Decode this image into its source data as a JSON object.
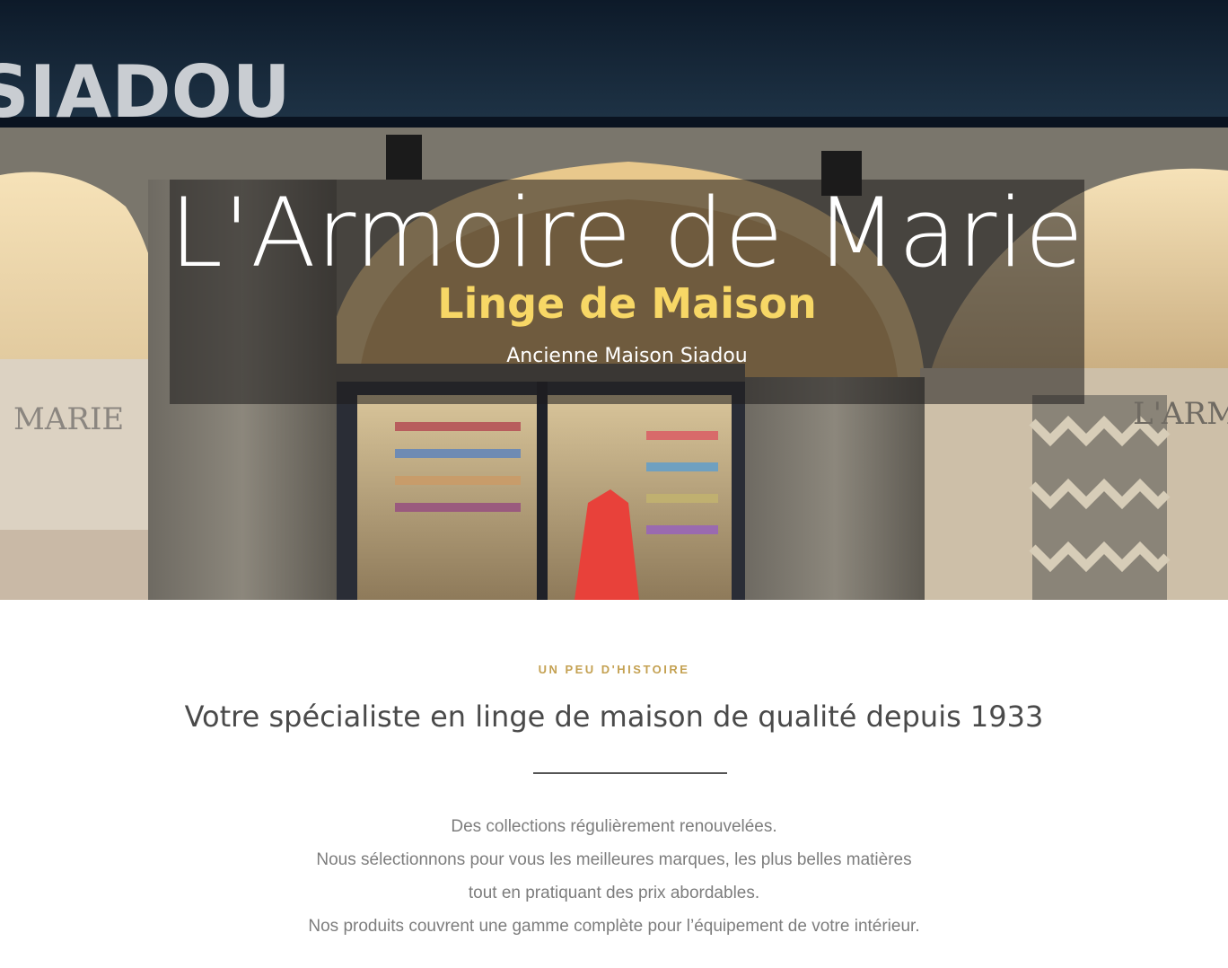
{
  "hero": {
    "title": "L'Armoire de Marie",
    "subtitle": "Linge de Maison",
    "tagline": "Ancienne Maison Siadou",
    "storefront_sign": "SIADOU",
    "window_sign_left": "MARIE",
    "window_sign_right": "L'ARM",
    "colors": {
      "subtitle": "#f7d766",
      "title": "#ffffff"
    }
  },
  "history": {
    "eyebrow": "UN PEU D'HISTOIRE",
    "headline": "Votre spécialiste en linge de maison de qualité depuis 1933",
    "lines": [
      "Des collections régulièrement renouvelées.",
      "Nous sélectionnons pour vous les meilleures marques, les plus belles matières",
      "tout en pratiquant des prix abordables.",
      "Nos produits couvrent une gamme complète pour l’équipement de votre intérieur."
    ],
    "colors": {
      "eyebrow": "#c4a152",
      "headline": "#4a4a4a",
      "body": "#7d7d7d"
    }
  }
}
